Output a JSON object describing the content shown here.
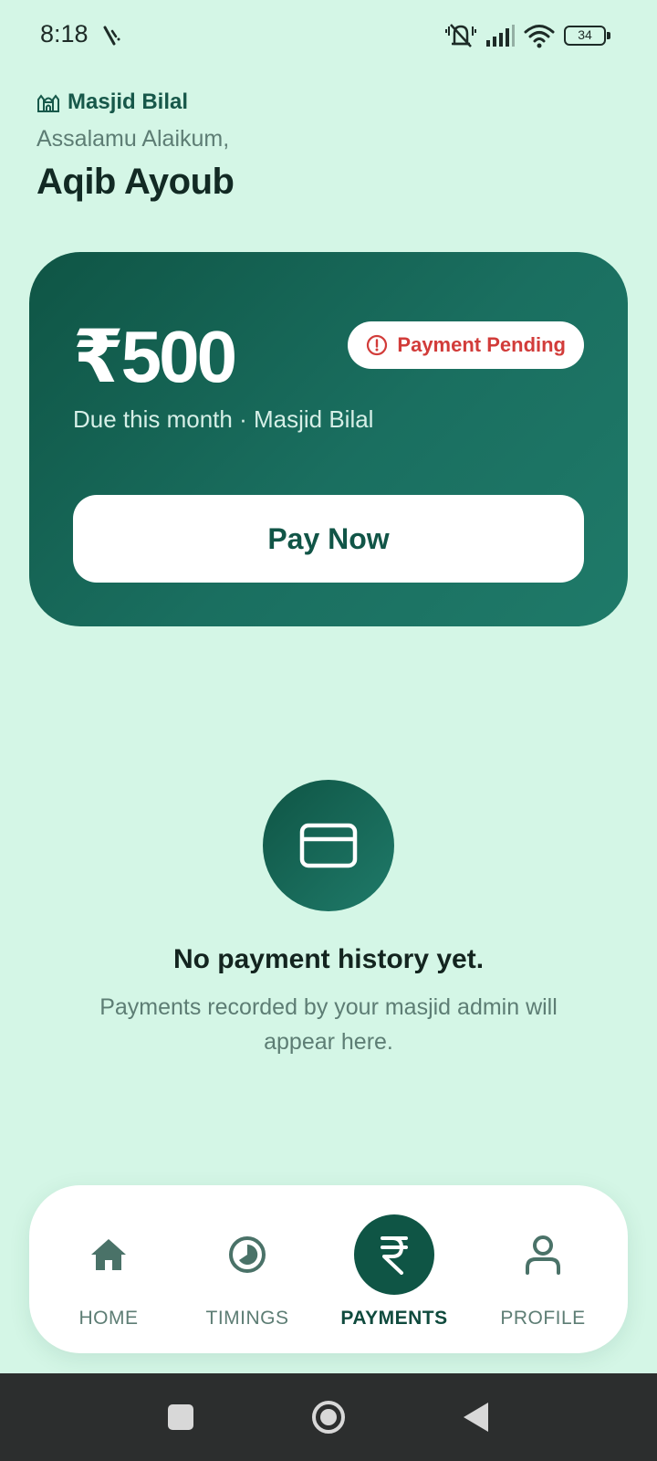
{
  "status_bar": {
    "time": "8:18",
    "battery": "34",
    "icons": [
      "silent-icon",
      "signal-icon",
      "wifi-icon",
      "battery-icon"
    ]
  },
  "header": {
    "mosque_name": "Masjid Bilal",
    "greeting": "Assalamu Alaikum,",
    "user_name": "Aqib Ayoub"
  },
  "due_card": {
    "amount": "₹500",
    "badge": "Payment Pending",
    "subtitle": "Due this month · Masjid Bilal",
    "pay_button": "Pay Now"
  },
  "empty_state": {
    "icon": "credit-card-icon",
    "title": "No payment history yet.",
    "subtitle": "Payments recorded by your masjid admin will appear here."
  },
  "bottom_nav": {
    "items": [
      {
        "label": "HOME",
        "icon": "home-icon",
        "active": false
      },
      {
        "label": "TIMINGS",
        "icon": "clock-icon",
        "active": false
      },
      {
        "label": "PAYMENTS",
        "icon": "rupee-icon",
        "active": true
      },
      {
        "label": "PROFILE",
        "icon": "person-icon",
        "active": false
      }
    ]
  },
  "colors": {
    "background": "#d4f6e6",
    "primary": "#0f5545",
    "pending": "#d23c3a",
    "muted_text": "#5d7d74"
  }
}
